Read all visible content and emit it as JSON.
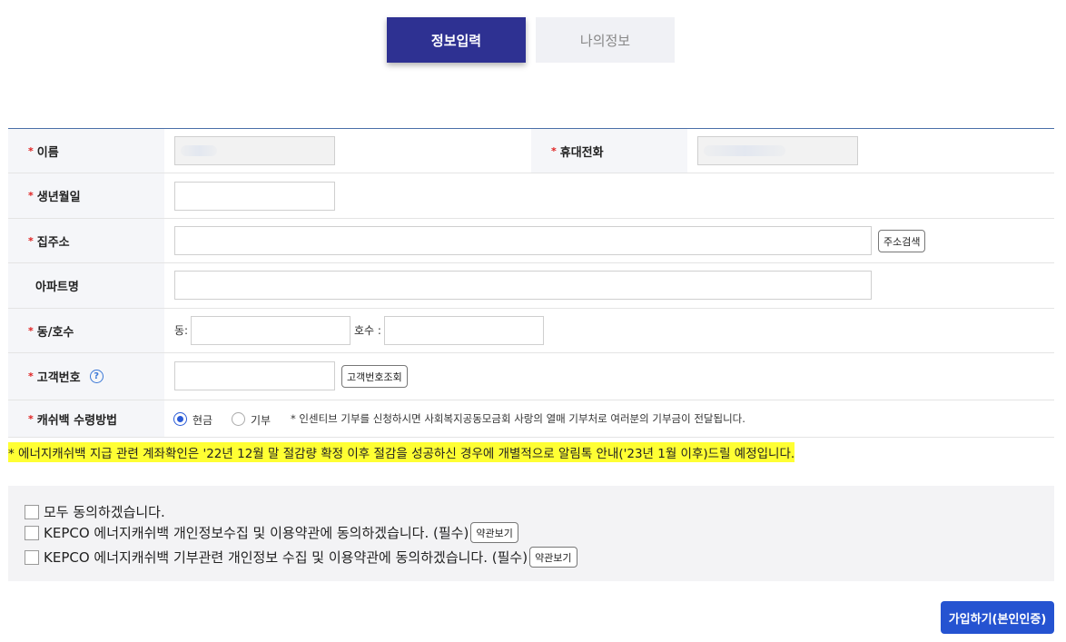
{
  "tabs": {
    "active": "정보입력",
    "inactive": "나의정보"
  },
  "form": {
    "name_label": "이름",
    "phone_label": "휴대전화",
    "birth_label": "생년월일",
    "address_label": "집주소",
    "address_search_btn": "주소검색",
    "apt_label": "아파트명",
    "unit_label": "동/호수",
    "dong_label": "동:",
    "ho_label": "호수 :",
    "customer_no_label": "고객번호",
    "help_icon": "?",
    "customer_no_btn": "고객번호조회",
    "cashback_label": "캐쉬백 수령방법",
    "option_cash": "현금",
    "option_donate": "기부",
    "cashback_note": "* 인센티브 기부를 신청하시면 사회복지공동모금회 사랑의 열매 기부처로 여러분의 기부금이 전달됩니다.",
    "required_mark": "*"
  },
  "notice": "* 에너지캐쉬백 지급 관련 계좌확인은 '22년 12월 말 절감량 확정 이후 절감을 성공하신 경우에 개별적으로 알림톡 안내('23년 1월 이후)드릴 예정입니다.",
  "agreements": {
    "all": "모두 동의하겠습니다.",
    "privacy": "KEPCO 에너지캐쉬백 개인정보수집 및 이용약관에 동의하겠습니다. (필수)",
    "donation": "KEPCO 에너지캐쉬백 기부관련 개인정보 수집 및 이용약관에 동의하겠습니다. (필수)",
    "terms_btn": "약관보기"
  },
  "submit_label": "가입하기(본인인증)",
  "colors": {
    "primary": "#2e3192",
    "submit": "#2553d1",
    "highlight": "#ffff33",
    "required": "#e02020"
  }
}
